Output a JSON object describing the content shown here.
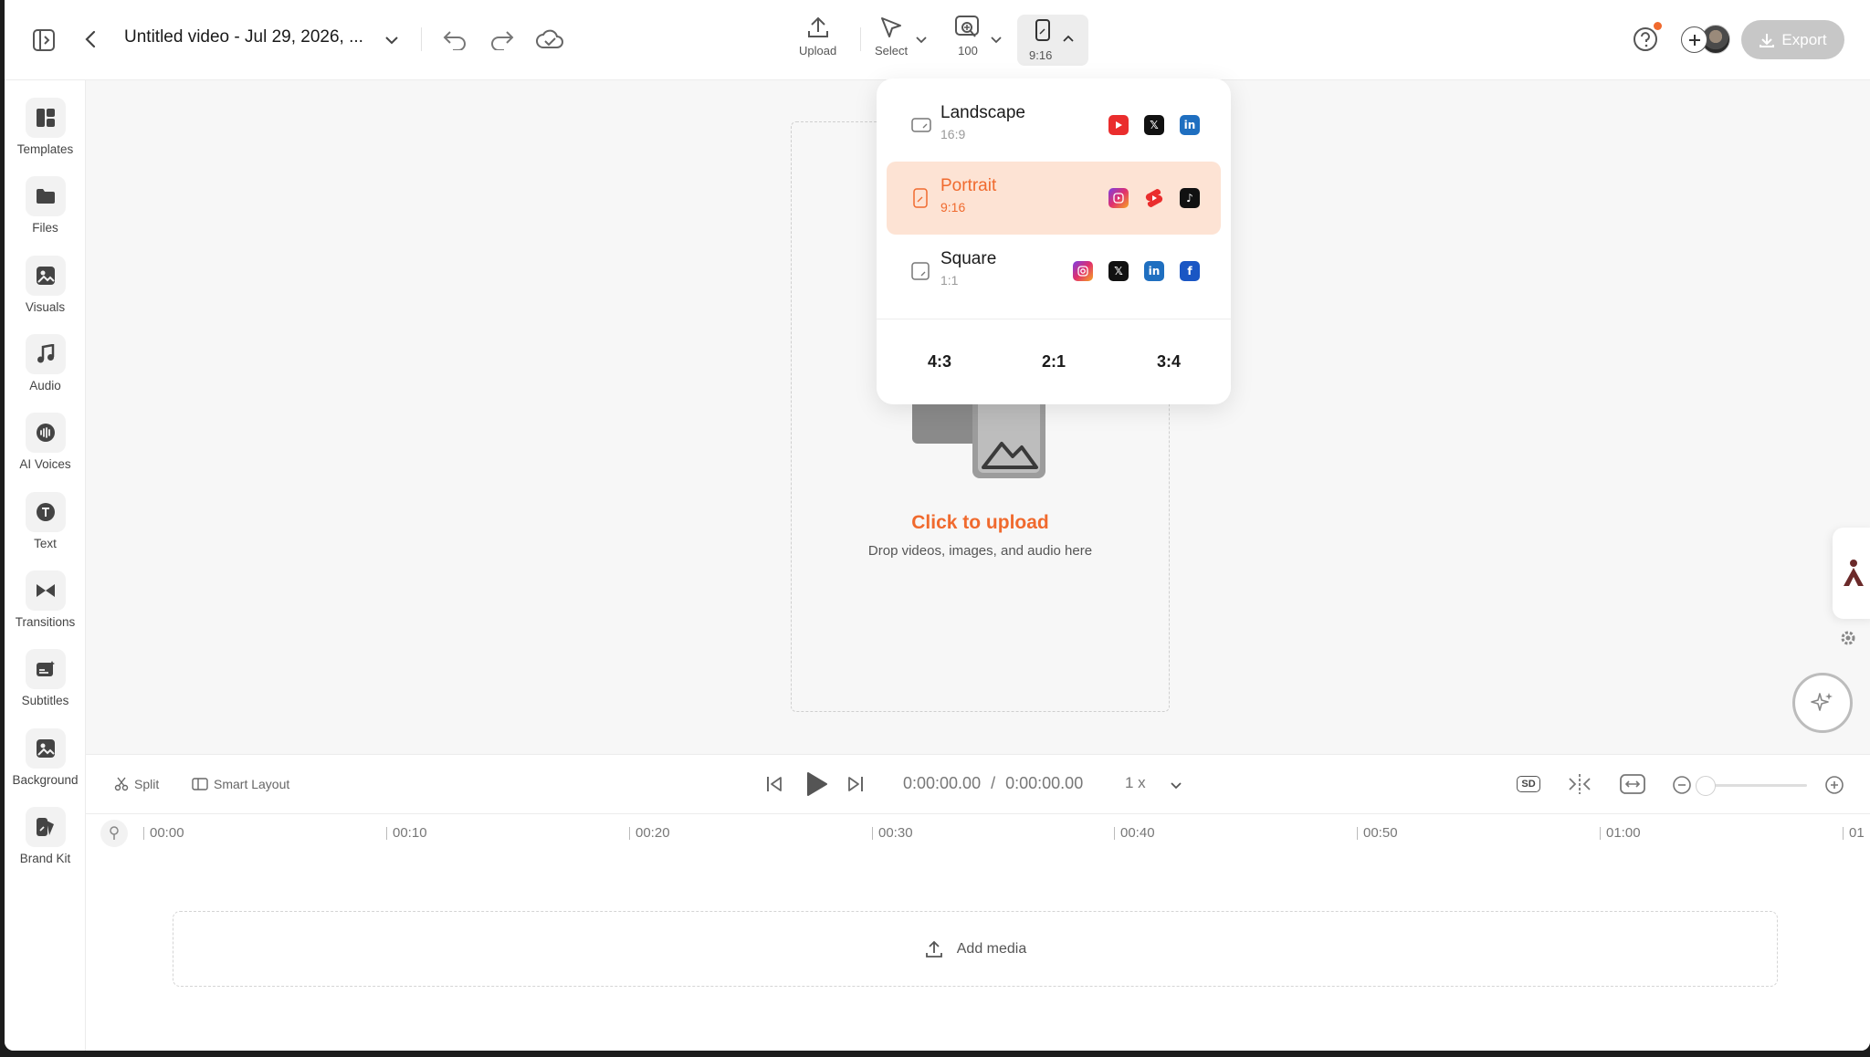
{
  "header": {
    "title": "Untitled video - Jul 29, 2026, ...",
    "tools": {
      "upload": "Upload",
      "select": "Select",
      "zoom": "100",
      "aspect": "9:16"
    },
    "export_label": "Export"
  },
  "sidebar": {
    "items": [
      {
        "label": "Templates",
        "icon": "templates-icon"
      },
      {
        "label": "Files",
        "icon": "folder-icon"
      },
      {
        "label": "Visuals",
        "icon": "image-icon"
      },
      {
        "label": "Audio",
        "icon": "music-icon"
      },
      {
        "label": "AI Voices",
        "icon": "voice-icon"
      },
      {
        "label": "Text",
        "icon": "text-icon"
      },
      {
        "label": "Transitions",
        "icon": "transition-icon"
      },
      {
        "label": "Subtitles",
        "icon": "subtitles-icon"
      },
      {
        "label": "Background",
        "icon": "background-icon"
      },
      {
        "label": "Brand Kit",
        "icon": "brand-kit-icon"
      }
    ]
  },
  "canvas": {
    "upload_cta": "Click to upload",
    "upload_sub": "Drop videos, images, and audio here"
  },
  "aspect_menu": {
    "options": [
      {
        "name": "Landscape",
        "ratio": "16:9",
        "selected": false
      },
      {
        "name": "Portrait",
        "ratio": "9:16",
        "selected": true
      },
      {
        "name": "Square",
        "ratio": "1:1",
        "selected": false
      }
    ],
    "extra": [
      "4:3",
      "2:1",
      "3:4"
    ]
  },
  "controls": {
    "split": "Split",
    "smart_layout": "Smart Layout",
    "current_time": "0:00:00.00",
    "separator": "/",
    "total_time": "0:00:00.00",
    "speed": "1 x",
    "quality": "SD"
  },
  "timeline": {
    "ticks": [
      "00:00",
      "00:10",
      "00:20",
      "00:30",
      "00:40",
      "00:50",
      "01:00",
      "01"
    ],
    "add_media": "Add media"
  },
  "colors": {
    "accent": "#f06a2e",
    "selected_bg": "#fde3d4"
  }
}
